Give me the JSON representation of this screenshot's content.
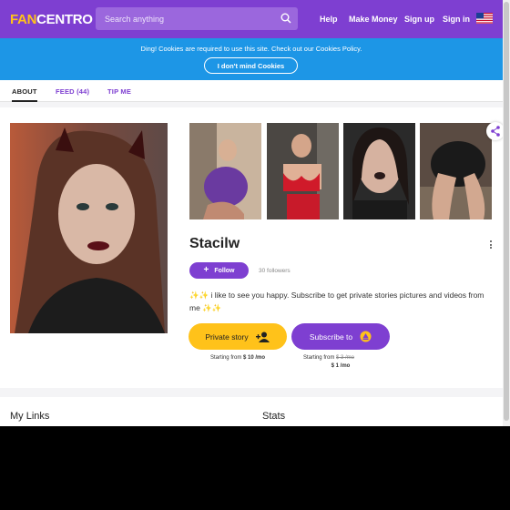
{
  "header": {
    "logo_fan": "FAN",
    "logo_centro": "CENTRO",
    "search_placeholder": "Search anything",
    "nav": [
      "Help",
      "Make Money",
      "Sign up",
      "Sign in"
    ],
    "brand_color": "#7e3fd1"
  },
  "cookie": {
    "message": "Ding! Cookies are required to use this site. Check out our Cookies Policy.",
    "button": "I don't mind Cookies"
  },
  "tabs": [
    "ABOUT",
    "FEED (44)",
    "TIP ME"
  ],
  "profile": {
    "name": "Stacilw",
    "follow_label": "Follow",
    "followers": "30 followers",
    "bio": "✨✨ i like to see you happy. Subscribe to get private stories pictures and videos from me ✨✨",
    "private_story_label": "Private story",
    "subscribe_label": "Subscribe to",
    "story_price_prefix": "Starting from",
    "story_price": "$ 10 /mo",
    "sub_price_prefix": "Starting from",
    "sub_price_old": "$ 3 /mo",
    "sub_price": "$ 1 /mo"
  },
  "sections": {
    "links_title": "My Links",
    "stats_title": "Stats"
  }
}
